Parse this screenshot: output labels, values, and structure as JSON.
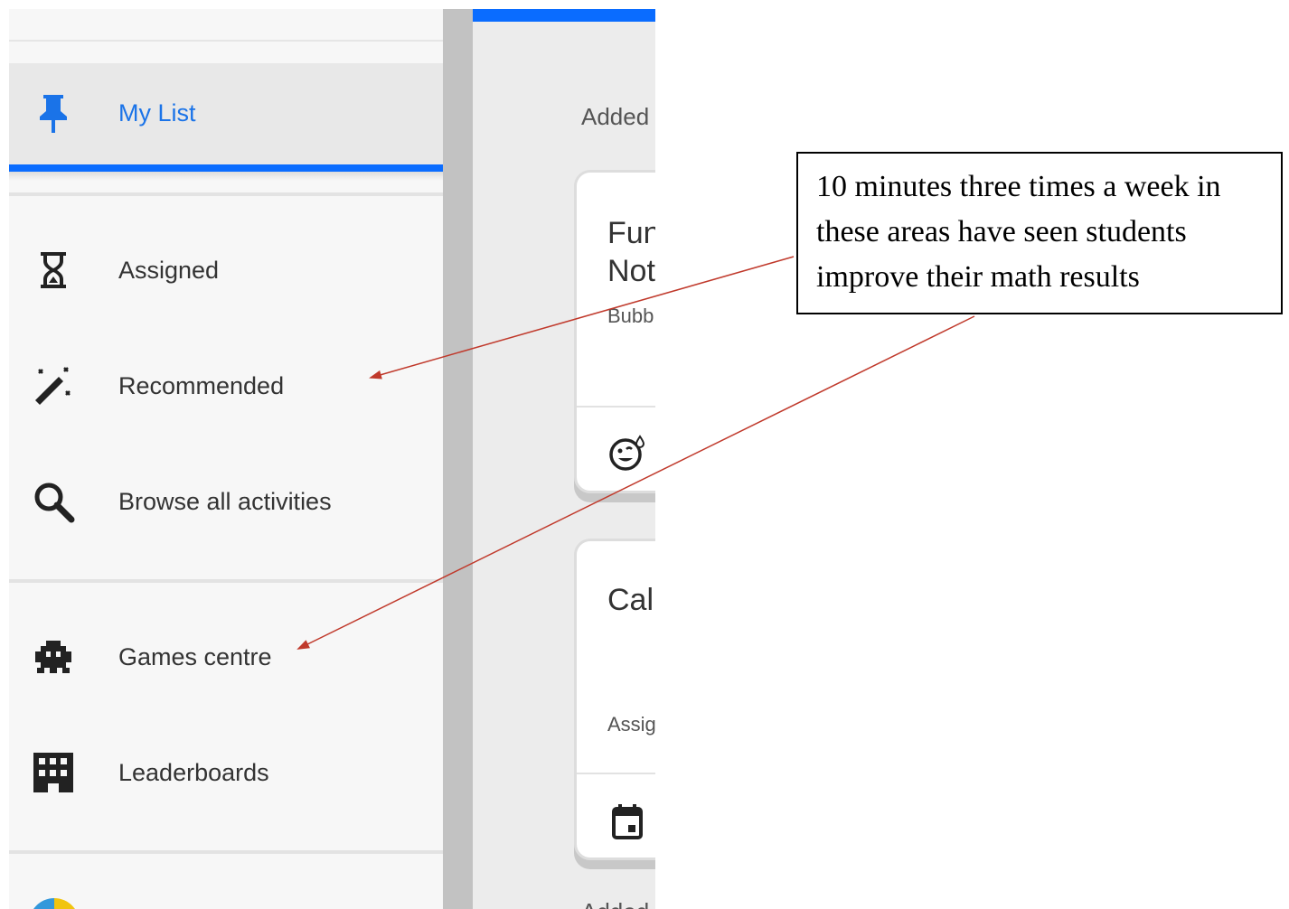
{
  "sidebar": {
    "items": [
      {
        "label": "My List",
        "icon": "pushpin-icon",
        "active": true
      },
      {
        "label": "Assigned",
        "icon": "hourglass-icon"
      },
      {
        "label": "Recommended",
        "icon": "magic-wand-icon"
      },
      {
        "label": "Browse all activities",
        "icon": "search-icon"
      },
      {
        "label": "Games centre",
        "icon": "space-invader-icon"
      },
      {
        "label": "Leaderboards",
        "icon": "building-icon"
      }
    ]
  },
  "main": {
    "section_label": "Added",
    "section_label_bottom": "Added",
    "cards": [
      {
        "title_line1": "Fun",
        "title_line2": "Not",
        "subtitle": "Bubb",
        "footer_icon": "smiling-sweat-face-icon"
      },
      {
        "title_line1": "Cal",
        "subtitle": "Assig",
        "footer_icon": "calendar-icon"
      }
    ]
  },
  "annotation": {
    "text": "10 minutes three times a week in these areas have seen students improve their math results",
    "arrow_color": "#c0392b"
  },
  "colors": {
    "accent": "#0a6cff",
    "active_label": "#1a73e8"
  }
}
